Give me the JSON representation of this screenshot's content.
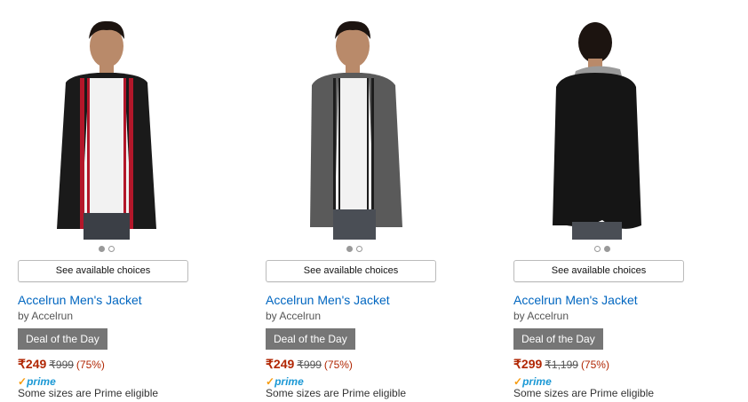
{
  "products": [
    {
      "title": "Accelrun Men's Jacket",
      "brand": "by Accelrun",
      "choices_label": "See available choices",
      "deal_label": "Deal of the Day",
      "price": "₹249",
      "original_price": "₹999",
      "discount": "(75%)",
      "prime_label": "prime",
      "prime_check": "✓",
      "prime_note": "Some sizes are Prime eligible",
      "image_color": "#1a1a1a",
      "accent_color": "#b3172a",
      "active_dot": 0
    },
    {
      "title": "Accelrun Men's Jacket",
      "brand": "by Accelrun",
      "choices_label": "See available choices",
      "deal_label": "Deal of the Day",
      "price": "₹249",
      "original_price": "₹999",
      "discount": "(75%)",
      "prime_label": "prime",
      "prime_check": "✓",
      "prime_note": "Some sizes are Prime eligible",
      "image_color": "#5a5a5a",
      "accent_color": "#1d1d1d",
      "active_dot": 0
    },
    {
      "title": "Accelrun Men's Jacket",
      "brand": "by Accelrun",
      "choices_label": "See available choices",
      "deal_label": "Deal of the Day",
      "price": "₹299",
      "original_price": "₹1,199",
      "discount": "(75%)",
      "prime_label": "prime",
      "prime_check": "✓",
      "prime_note": "Some sizes are Prime eligible",
      "image_color": "#151515",
      "accent_color": "#9a9a9a",
      "active_dot": 1
    }
  ],
  "colors": {
    "link": "#0066c0",
    "price": "#b12704",
    "deal_badge": "#767676",
    "prime_blue": "#1a98d5",
    "prime_check": "#f79c11"
  }
}
